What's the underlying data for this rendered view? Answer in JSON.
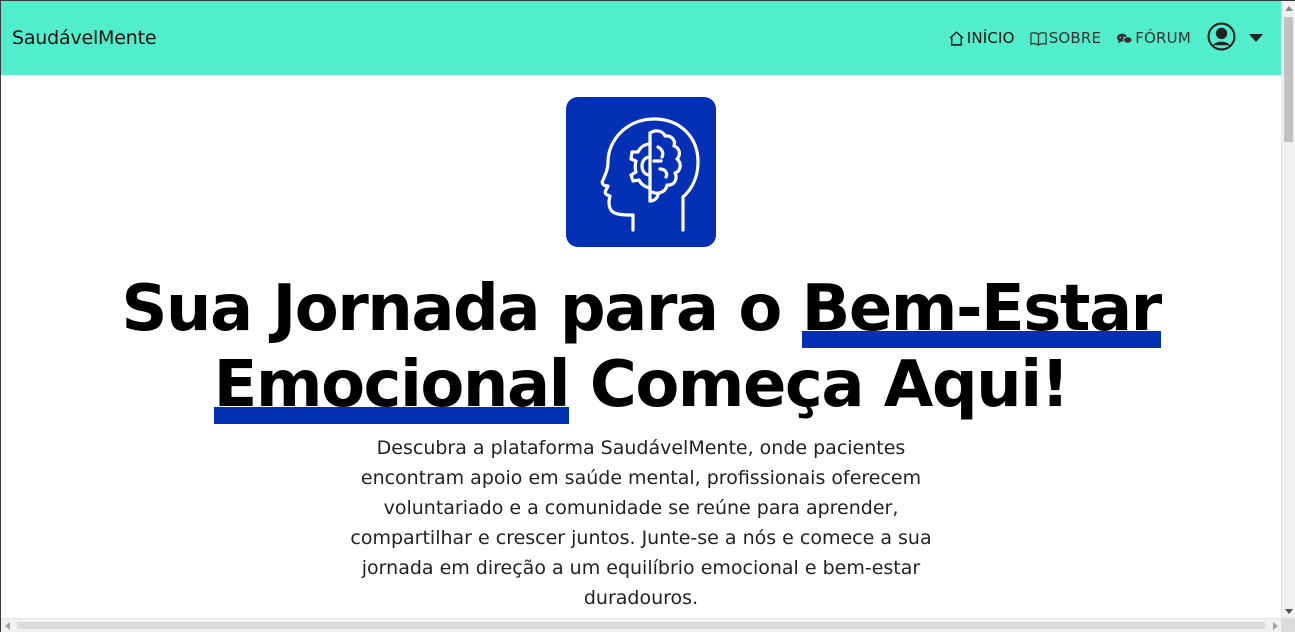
{
  "navbar": {
    "brand": "SaudávelMente",
    "bg_color": "#52eecb",
    "links": [
      {
        "label": "INÍCIO",
        "icon": "home-icon",
        "active": true
      },
      {
        "label": "SOBRE",
        "icon": "book-icon",
        "active": false
      },
      {
        "label": "FÓRUM",
        "icon": "chat-icon",
        "active": false
      }
    ],
    "user_menu": {
      "icon": "user-circle-icon",
      "dropdown_icon": "caret-down-icon"
    }
  },
  "hero": {
    "logo": {
      "icon": "brain-gear-head-icon",
      "bg_color": "#0330b4"
    },
    "title_part1": "Sua Jornada para o ",
    "title_highlight1": "Bem-Estar",
    "title_highlight2": "Emocional",
    "title_part2": " Começa Aqui!",
    "highlight_color": "#0330b4",
    "description": "Descubra a plataforma SaudávelMente, onde pacientes encontram apoio em saúde mental, profissionais oferecem voluntariado e a comunidade se reúne para aprender, compartilhar e crescer juntos. Junte-se a nós e comece a sua jornada em direção a um equilíbrio emocional e bem-estar duradouros."
  }
}
